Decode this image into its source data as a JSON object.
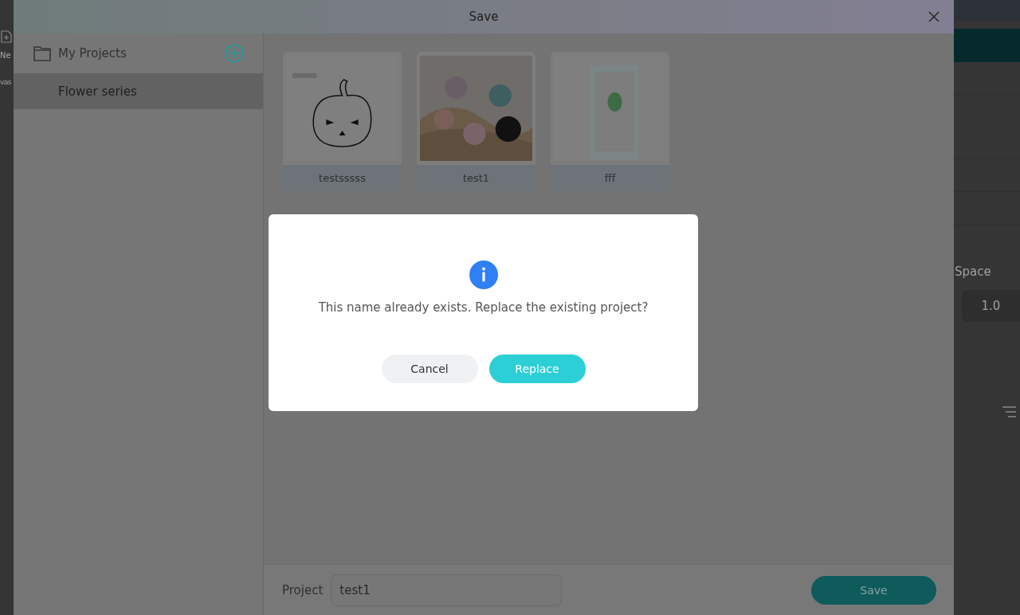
{
  "background_app": {
    "left_texts": [
      "Ne",
      "vas"
    ],
    "right": {
      "label": "Space",
      "value": "1.0"
    }
  },
  "dialog": {
    "title": "Save",
    "sidebar": {
      "header": "My Projects",
      "items": [
        {
          "label": "Flower series",
          "selected": true
        }
      ]
    },
    "projects": [
      {
        "name": "testsssss",
        "kind": "picture"
      },
      {
        "name": "test1",
        "kind": "picture"
      },
      {
        "name": "fff",
        "kind": "picture"
      }
    ],
    "footer": {
      "label": "Project",
      "value": "test1",
      "button": "Save"
    }
  },
  "confirm": {
    "message": "This name already exists. Replace the existing project?",
    "buttons": [
      {
        "label": "Cancel",
        "kind": "secondary"
      },
      {
        "label": "Replace",
        "kind": "primary"
      }
    ]
  }
}
